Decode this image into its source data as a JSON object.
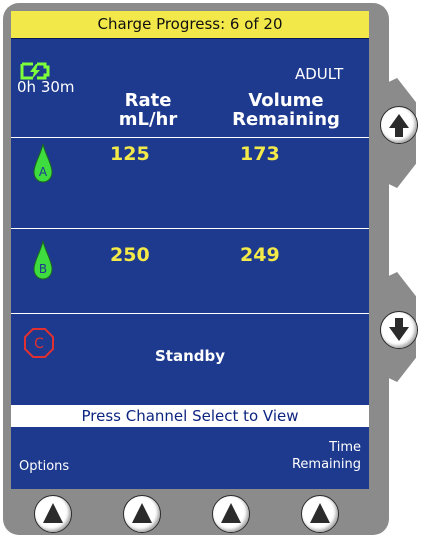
{
  "status_bar": {
    "title": "Charge Progress: 6 of 20"
  },
  "battery": {
    "icon": "battery-charging-icon",
    "time_label": "0h 30m",
    "color": "#7dff3a"
  },
  "patient_mode": "ADULT",
  "columns": {
    "rate_line1": "Rate",
    "rate_line2": "mL/hr",
    "volume_line1": "Volume",
    "volume_line2": "Remaining"
  },
  "channels": [
    {
      "letter": "A",
      "rate": "125",
      "volume": "173",
      "icon": "drop-icon",
      "color": "#3fdc3f"
    },
    {
      "letter": "B",
      "rate": "250",
      "volume": "249",
      "icon": "drop-icon",
      "color": "#3fdc3f"
    },
    {
      "letter": "C",
      "status": "Standby",
      "icon": "stop-octagon-icon",
      "color": "#e23030"
    }
  ],
  "message": "Press Channel Select to View",
  "softkeys": {
    "left": "Options",
    "right_line1": "Time",
    "right_line2": "Remaining"
  },
  "buttons": {
    "side": [
      "up-arrow-icon",
      "down-arrow-icon"
    ],
    "bottom": [
      "up-arrow-icon",
      "up-arrow-icon",
      "up-arrow-icon",
      "up-arrow-icon"
    ]
  },
  "colors": {
    "screen_bg": "#1e3a8e",
    "value_text": "#f3ea4a",
    "status_bar_bg": "#f2e84a"
  }
}
